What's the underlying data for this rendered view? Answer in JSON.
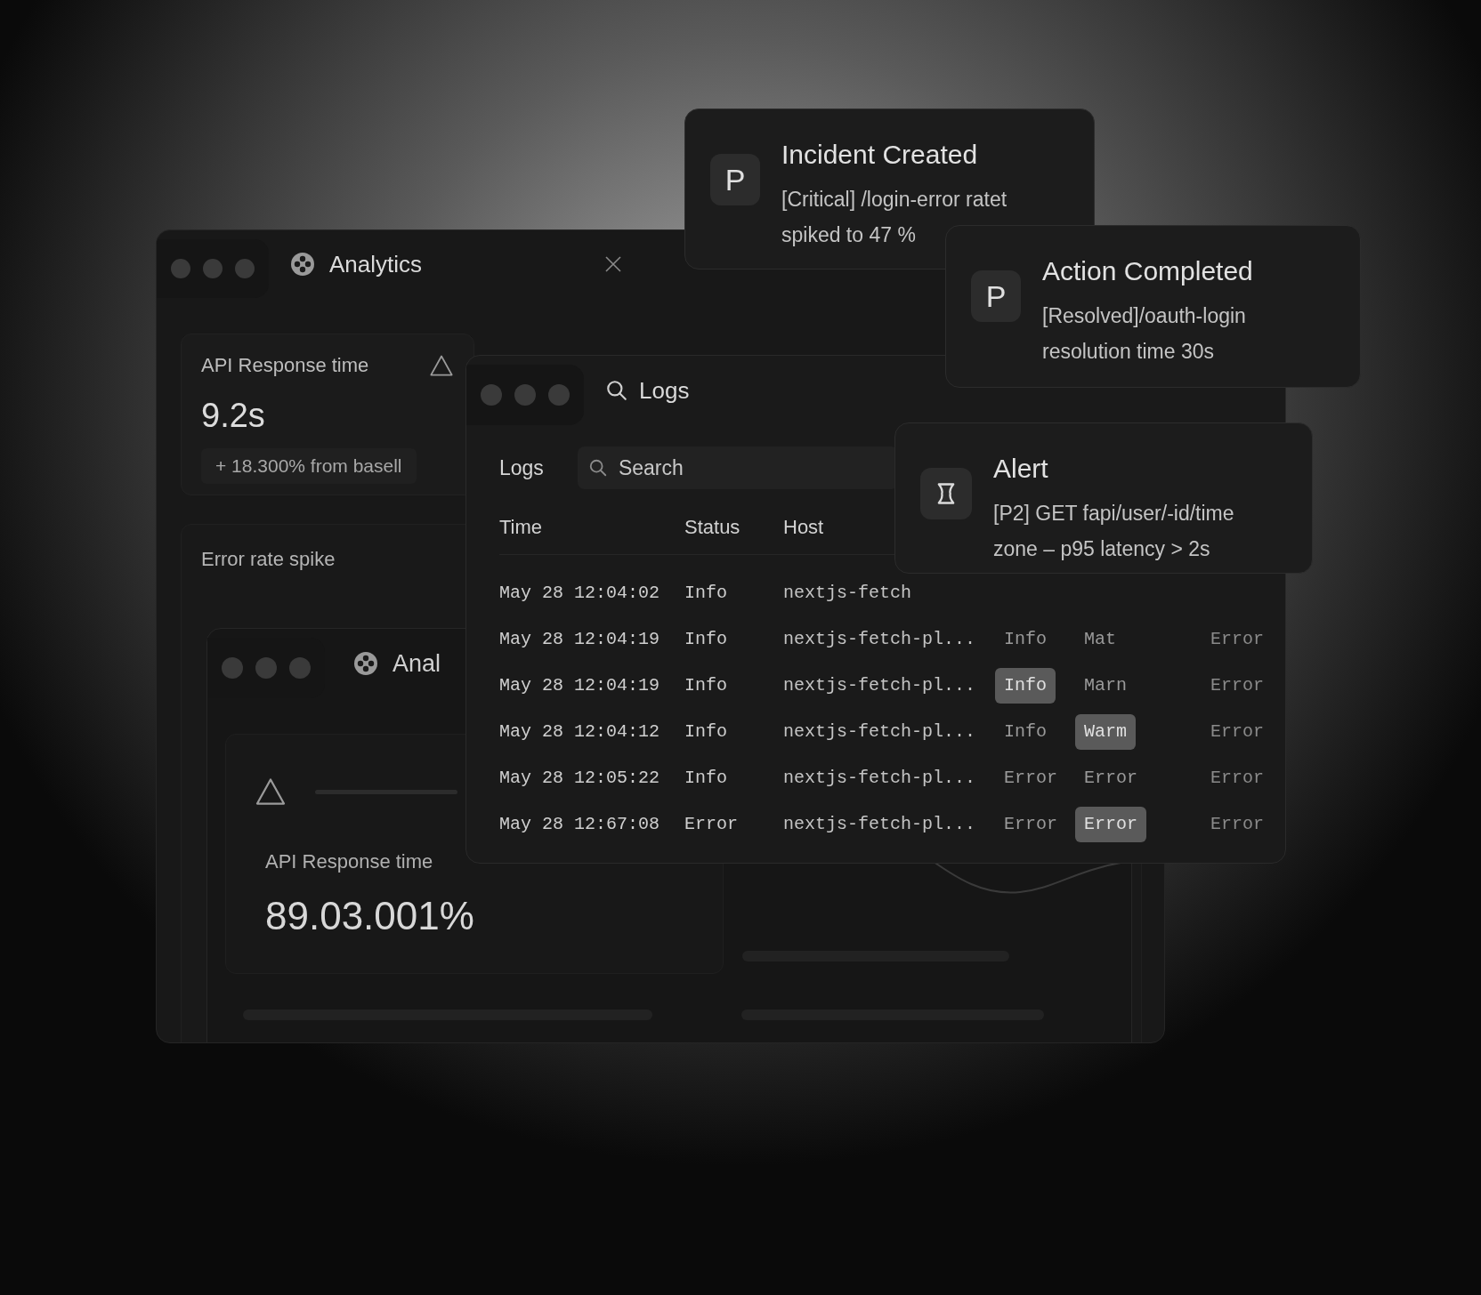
{
  "analytics_window": {
    "title": "Analytics",
    "response_card": {
      "title": "API Response time",
      "value": "9.2s",
      "delta": "+ 18.300% from basell"
    },
    "spike_card": {
      "title": "Error rate spike"
    },
    "inner_window": {
      "title": "Anal",
      "metric_label": "API Response time",
      "metric_value": "89.03.001%"
    }
  },
  "logs_window": {
    "title": "Logs",
    "toolbar_label": "Logs",
    "search": {
      "placeholder": "Search"
    },
    "columns": [
      "Time",
      "Status",
      "Host"
    ],
    "rows": [
      {
        "cells": [
          {
            "text": "May 28 12:04:02",
            "highlighted": false
          },
          {
            "text": "Info",
            "highlighted": false
          },
          {
            "text": "nextjs-fetch",
            "highlighted": false
          }
        ]
      },
      {
        "cells": [
          {
            "text": "May 28 12:04:19",
            "highlighted": false
          },
          {
            "text": "Info",
            "highlighted": false
          },
          {
            "text": "nextjs-fetch-pl...",
            "highlighted": false
          },
          {
            "text": "Info",
            "highlighted": false
          },
          {
            "text": "Mat",
            "highlighted": false
          },
          {
            "text": "Error",
            "highlighted": false
          }
        ]
      },
      {
        "cells": [
          {
            "text": "May 28 12:04:19",
            "highlighted": false
          },
          {
            "text": "Info",
            "highlighted": false
          },
          {
            "text": "nextjs-fetch-pl...",
            "highlighted": false
          },
          {
            "text": "Info",
            "highlighted": true
          },
          {
            "text": "Marn",
            "highlighted": false
          },
          {
            "text": "Error",
            "highlighted": false
          }
        ]
      },
      {
        "cells": [
          {
            "text": "May 28 12:04:12",
            "highlighted": false
          },
          {
            "text": "Info",
            "highlighted": false
          },
          {
            "text": "nextjs-fetch-pl...",
            "highlighted": false
          },
          {
            "text": "Info",
            "highlighted": false
          },
          {
            "text": "Warm",
            "highlighted": true
          },
          {
            "text": "Error",
            "highlighted": false
          }
        ]
      },
      {
        "cells": [
          {
            "text": "May 28 12:05:22",
            "highlighted": false
          },
          {
            "text": "Info",
            "highlighted": false
          },
          {
            "text": "nextjs-fetch-pl...",
            "highlighted": false
          },
          {
            "text": "Error",
            "highlighted": false
          },
          {
            "text": "Error",
            "highlighted": false
          },
          {
            "text": "Error",
            "highlighted": false
          }
        ]
      },
      {
        "cells": [
          {
            "text": "May 28 12:67:08",
            "highlighted": false
          },
          {
            "text": "Error",
            "highlighted": false
          },
          {
            "text": "nextjs-fetch-pl...",
            "highlighted": false
          },
          {
            "text": "Error",
            "highlighted": false
          },
          {
            "text": "Error",
            "highlighted": true
          },
          {
            "text": "Error",
            "highlighted": false
          }
        ]
      }
    ]
  },
  "notifications": [
    {
      "kind": "letter",
      "icon_text": "P",
      "title": "Incident Created",
      "body": "[Critical] /login-error ratet spiked to 47 %"
    },
    {
      "kind": "letter",
      "icon_text": "P",
      "title": "Action Completed",
      "body": "[Resolved]/oauth-login resolution time 30s"
    },
    {
      "kind": "alert",
      "title": "Alert",
      "body": "[P2] GET fapi/user/-id/time zone – p95 latency > 2s"
    }
  ]
}
